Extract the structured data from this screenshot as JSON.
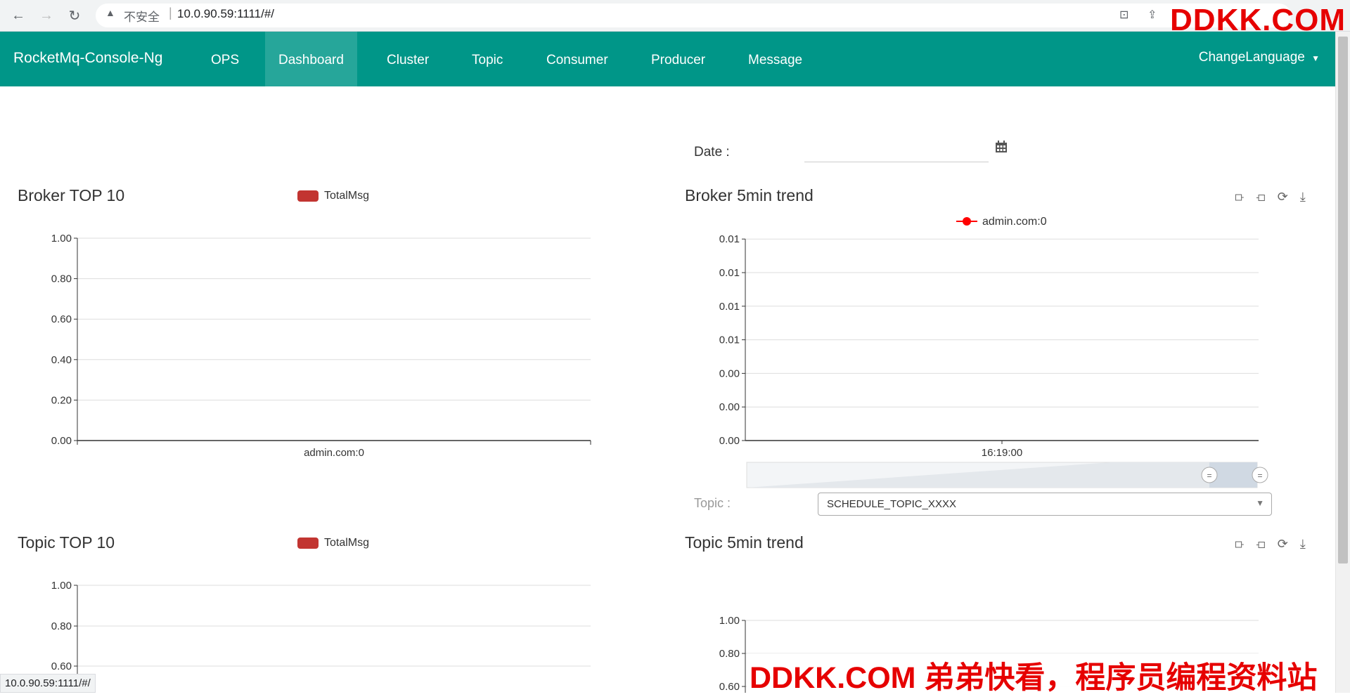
{
  "browser": {
    "insecure_label": "不安全",
    "url": "10.0.90.59:1111/#/",
    "status_url": "10.0.90.59:1111/#/",
    "watermark_top": "DDKK.COM",
    "watermark_bottom": "DDKK.COM 弟弟快看，程序员编程资料站"
  },
  "nav": {
    "brand": "RocketMq-Console-Ng",
    "items": [
      {
        "label": "OPS",
        "active": false
      },
      {
        "label": "Dashboard",
        "active": true
      },
      {
        "label": "Cluster",
        "active": false
      },
      {
        "label": "Topic",
        "active": false
      },
      {
        "label": "Consumer",
        "active": false
      },
      {
        "label": "Producer",
        "active": false
      },
      {
        "label": "Message",
        "active": false
      }
    ],
    "change_language": "ChangeLanguage"
  },
  "filters": {
    "date_label": "Date :",
    "date_value": "",
    "topic_label": "Topic :",
    "topic_selected": "SCHEDULE_TOPIC_XXXX"
  },
  "colors": {
    "nav_bg": "#009688",
    "nav_active": "#26a69a",
    "series": "#c23531"
  },
  "chart_data": [
    {
      "type": "bar",
      "title": "Broker TOP 10",
      "legend": [
        "TotalMsg"
      ],
      "categories": [
        "admin.com:0"
      ],
      "series": [
        {
          "name": "TotalMsg",
          "values": [
            0
          ]
        }
      ],
      "yticks": [
        "0.00",
        "0.20",
        "0.40",
        "0.60",
        "0.80",
        "1.00"
      ],
      "ylim": [
        0,
        1
      ],
      "grid": true,
      "legend_position": "top-center"
    },
    {
      "type": "line",
      "title": "Broker 5min trend",
      "legend": [
        "admin.com:0"
      ],
      "x": [
        "16:19:00"
      ],
      "series": [
        {
          "name": "admin.com:0",
          "values": [
            0
          ]
        }
      ],
      "yticks": [
        "0.00",
        "0.00",
        "0.00",
        "0.01",
        "0.01",
        "0.01",
        "0.01"
      ],
      "grid": true,
      "legend_position": "top-center",
      "toolbox": [
        "data-zoom-icon",
        "zoom-reset-icon",
        "restore-icon",
        "save-image-icon"
      ]
    },
    {
      "type": "bar",
      "title": "Topic TOP 10",
      "legend": [
        "TotalMsg"
      ],
      "categories": [],
      "series": [
        {
          "name": "TotalMsg",
          "values": []
        }
      ],
      "yticks": [
        "0.60",
        "0.80",
        "1.00"
      ],
      "ylim": [
        0,
        1
      ],
      "grid": true,
      "legend_position": "top-center"
    },
    {
      "type": "line",
      "title": "Topic 5min trend",
      "x": [],
      "series": [],
      "yticks": [
        "0.60",
        "0.80",
        "1.00"
      ],
      "grid": true,
      "toolbox": [
        "data-zoom-icon",
        "zoom-reset-icon",
        "restore-icon",
        "save-image-icon"
      ]
    }
  ]
}
